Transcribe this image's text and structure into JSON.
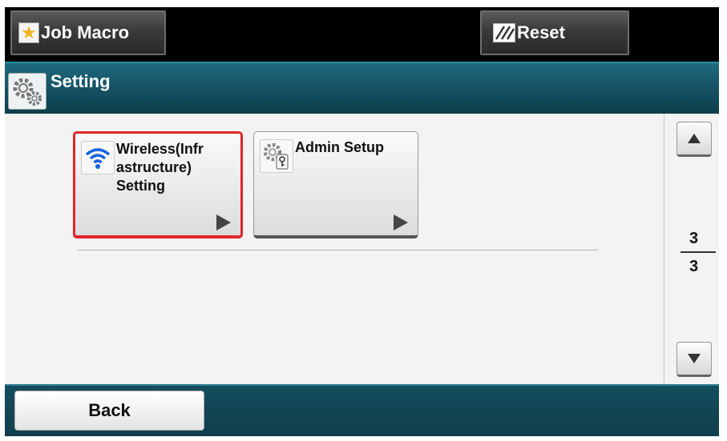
{
  "topbar": {
    "job_macro_label": "Job Macro",
    "reset_label": "Reset"
  },
  "titlebar": {
    "title": "Setting"
  },
  "menu": {
    "items": [
      {
        "lines": [
          "Wireless(Infr",
          "astructure)",
          "Setting"
        ],
        "icon": "wifi-icon",
        "selected": true
      },
      {
        "lines": [
          "Admin Setup"
        ],
        "icon": "gear-key-icon",
        "selected": false
      }
    ]
  },
  "pager": {
    "current": "3",
    "total": "3"
  },
  "bottombar": {
    "back_label": "Back"
  },
  "colors": {
    "selection_border": "#e0262d",
    "titlebar": "#144f60",
    "wifi": "#1a63e0"
  }
}
